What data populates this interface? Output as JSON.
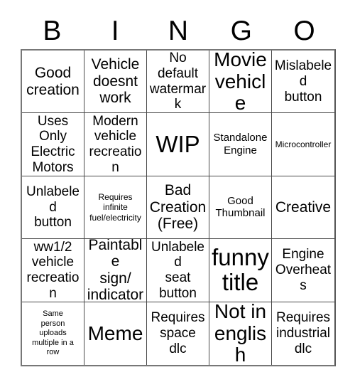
{
  "card": {
    "header_letters": [
      "B",
      "I",
      "N",
      "G",
      "O"
    ],
    "columns": 5,
    "rows": 5,
    "colors": {
      "background": "#ffffff",
      "text": "#000000",
      "grid_line": "#4a4a4a",
      "outer_border": "#777777"
    },
    "cells": [
      {
        "text": "Good\ncreation",
        "size": "lg"
      },
      {
        "text": "Vehicle\ndoesnt\nwork",
        "size": "lg"
      },
      {
        "text": "No default\nwatermark",
        "size": "md"
      },
      {
        "text": "Movie\nvehicle",
        "size": "xl"
      },
      {
        "text": "Mislabeled\nbutton",
        "size": "md"
      },
      {
        "text": "Uses Only\nElectric\nMotors",
        "size": "md"
      },
      {
        "text": "Modern\nvehicle\nrecreation",
        "size": "md"
      },
      {
        "text": "WIP",
        "size": "xxl"
      },
      {
        "text": "Standalone\nEngine",
        "size": "sm"
      },
      {
        "text": "Microcontroller",
        "size": "xs"
      },
      {
        "text": "Unlabeled\nbutton",
        "size": "md"
      },
      {
        "text": "Requires\ninfinite\nfuel/electricity",
        "size": "xs"
      },
      {
        "text": "Bad\nCreation\n(Free)",
        "size": "lg"
      },
      {
        "text": "Good\nThumbnail",
        "size": "sm"
      },
      {
        "text": "Creative",
        "size": "lg"
      },
      {
        "text": "ww1/2\nvehicle\nrecreation",
        "size": "md"
      },
      {
        "text": "Paintable\nsign/\nindicator",
        "size": "lg"
      },
      {
        "text": "Unlabeled\nseat\nbutton",
        "size": "md"
      },
      {
        "text": "funny\ntitle",
        "size": "xxl"
      },
      {
        "text": "Engine\nOverheats",
        "size": "md"
      },
      {
        "text": "Same\nperson\nuploads\nmultiple in a\nrow",
        "size": "xxs"
      },
      {
        "text": "Meme",
        "size": "xl"
      },
      {
        "text": "Requires\nspace\ndlc",
        "size": "md"
      },
      {
        "text": "Not in\nenglish",
        "size": "xl"
      },
      {
        "text": "Requires\nindustrial\ndlc",
        "size": "md"
      }
    ]
  }
}
